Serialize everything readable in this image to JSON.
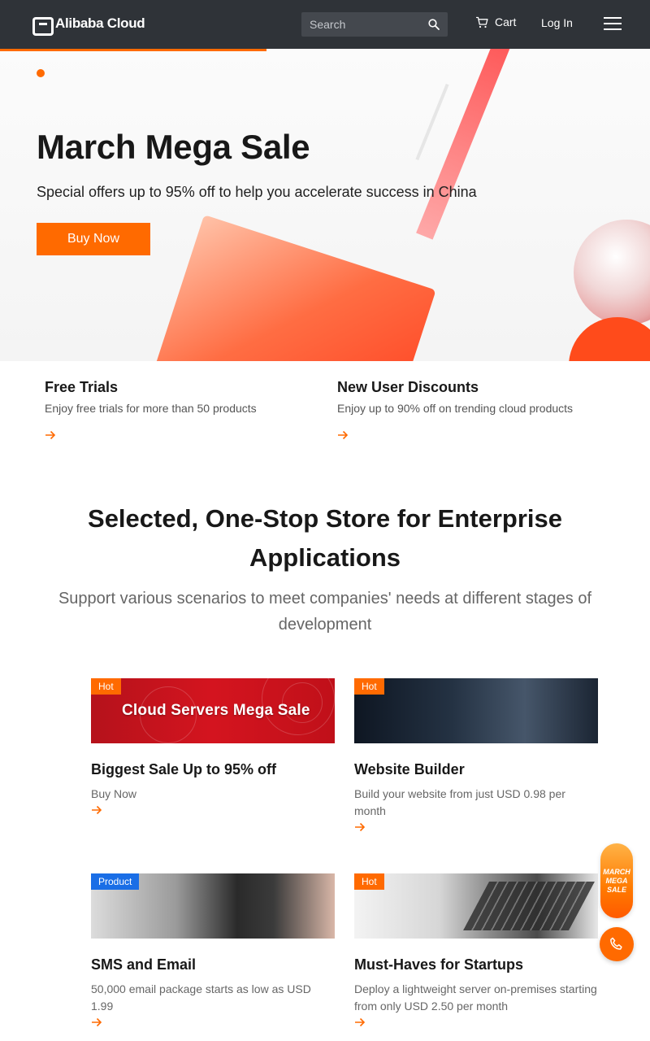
{
  "header": {
    "logo_text": "Alibaba Cloud",
    "search_placeholder": "Search",
    "cart_label": "Cart",
    "login_label": "Log In"
  },
  "hero": {
    "title": "March Mega Sale",
    "subtitle": "Special offers up to 95% off to help you accelerate success in China",
    "button_label": "Buy Now",
    "carousel_progress": 0.41
  },
  "promos": [
    {
      "title": "Free Trials",
      "description": "Enjoy free trials for more than 50 products"
    },
    {
      "title": "New User Discounts",
      "description": "Enjoy up to 90% off on trending cloud products"
    }
  ],
  "section": {
    "title": "Selected, One-Stop Store for Enterprise Applications",
    "subtitle": "Support various scenarios to meet companies' needs at different stages of development"
  },
  "cards": [
    {
      "tag": "Hot",
      "image_caption": "Cloud Servers Mega Sale",
      "title": "Biggest Sale Up to 95% off",
      "description": "Buy Now"
    },
    {
      "tag": "Hot",
      "title": "Website Builder",
      "description": "Build your website from just USD 0.98 per month"
    },
    {
      "tag": "Product",
      "title": "SMS and Email",
      "description": "50,000 email package starts as low as USD 1.99"
    },
    {
      "tag": "Hot",
      "title": "Must-Haves for Startups",
      "description": "Deploy a lightweight server on-premises starting from only USD 2.50 per month"
    }
  ],
  "float_widget": {
    "line1": "MARCH",
    "line2": "MEGA",
    "line3": "SALE"
  },
  "colors": {
    "accent": "#ff6a00",
    "header_bg": "#2f3338",
    "tag_product": "#1a6ee6"
  },
  "icons": [
    "search-icon",
    "cart-icon",
    "menu-icon",
    "arrow-right-icon",
    "phone-icon"
  ]
}
